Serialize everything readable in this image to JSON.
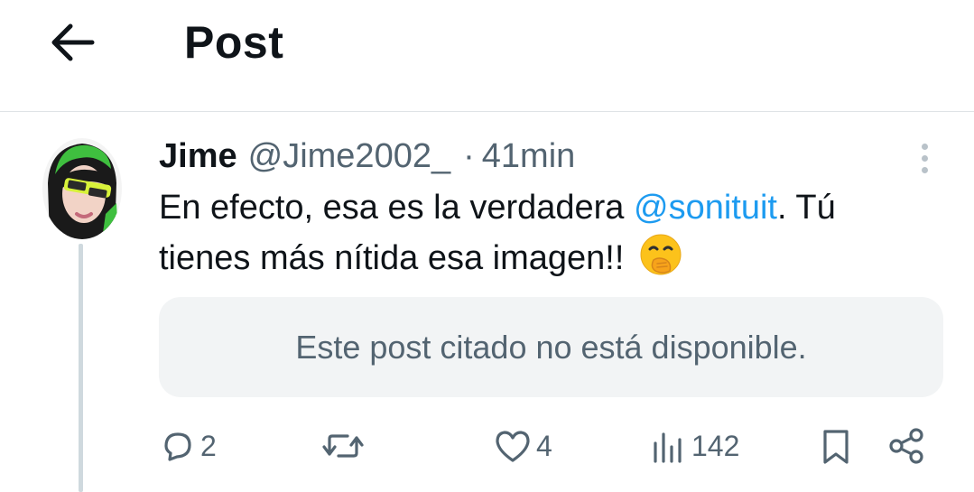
{
  "header": {
    "back_icon": "arrow-left-icon",
    "title": "Post"
  },
  "post": {
    "author_name": "Jime",
    "author_handle": "@Jime2002_",
    "separator": "·",
    "timestamp": "41min",
    "text_part1": "En efecto, esa es la verdadera ",
    "mention": "@sonituit",
    "text_part2": ". Tú tienes más nítida esa imagen!! ",
    "emoji": "face-with-hand-over-mouth",
    "quote_unavailable": "Este post citado no está disponible."
  },
  "actions": {
    "replies": "2",
    "reposts": "",
    "likes": "4",
    "views": "142"
  },
  "colors": {
    "text_primary": "#0f1419",
    "text_secondary": "#536471",
    "link": "#1d9bf0",
    "quote_bg": "#f2f4f5",
    "thread_line": "#cfd9de"
  }
}
